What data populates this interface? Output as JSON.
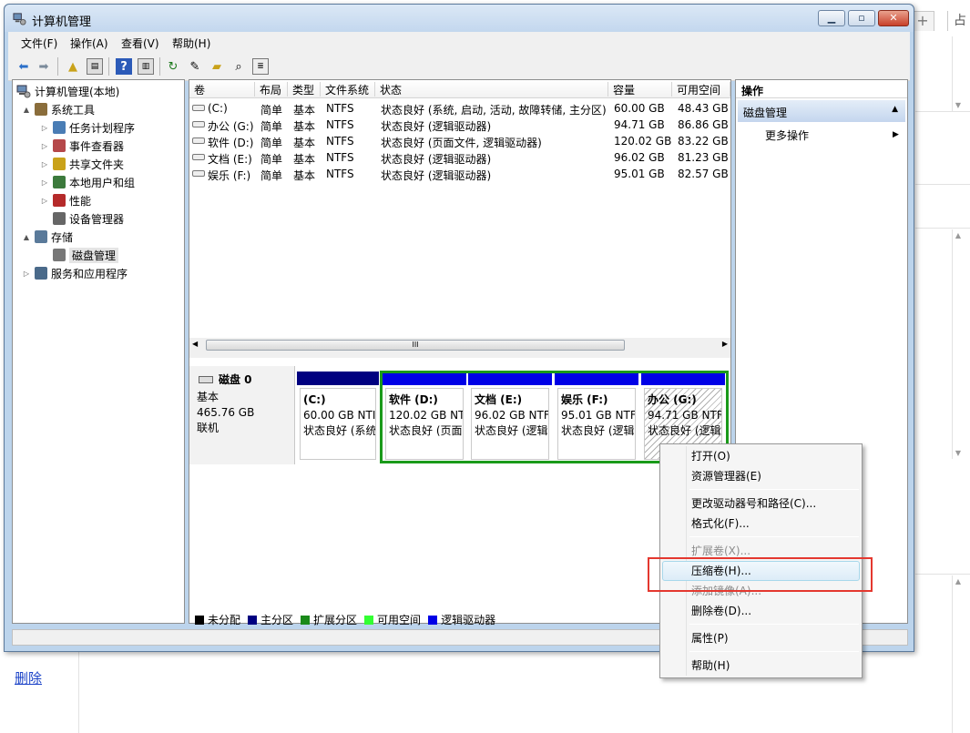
{
  "window": {
    "title": "计算机管理",
    "colors": {
      "accent": "#0000e6",
      "primary_partition": "#000080",
      "extended_partition": "#1a9a1a",
      "highlight": "#e4382f"
    }
  },
  "menubar": [
    "文件(F)",
    "操作(A)",
    "查看(V)",
    "帮助(H)"
  ],
  "toolbar": {
    "icons": [
      "back-arrow-icon",
      "forward-arrow-icon",
      "up-folder-icon",
      "show-hide-tree-icon",
      "help-icon",
      "show-hide-action-icon",
      "refresh-icon",
      "properties-icon",
      "open-folder-icon",
      "search-icon",
      "properties-list-icon"
    ]
  },
  "tree": {
    "root": "计算机管理(本地)",
    "items": [
      {
        "label": "系统工具",
        "level": 1,
        "expander": "▲",
        "icon": "tools-icon"
      },
      {
        "label": "任务计划程序",
        "level": 2,
        "expander": "▷",
        "icon": "clock-icon"
      },
      {
        "label": "事件查看器",
        "level": 2,
        "expander": "▷",
        "icon": "event-viewer-icon"
      },
      {
        "label": "共享文件夹",
        "level": 2,
        "expander": "▷",
        "icon": "shared-folder-icon"
      },
      {
        "label": "本地用户和组",
        "level": 2,
        "expander": "▷",
        "icon": "users-icon"
      },
      {
        "label": "性能",
        "level": 2,
        "expander": "▷",
        "icon": "performance-icon"
      },
      {
        "label": "设备管理器",
        "level": 2,
        "expander": "",
        "icon": "device-manager-icon"
      },
      {
        "label": "存储",
        "level": 1,
        "expander": "▲",
        "icon": "storage-icon"
      },
      {
        "label": "磁盘管理",
        "level": 2,
        "expander": "",
        "icon": "disk-management-icon",
        "selected": true
      },
      {
        "label": "服务和应用程序",
        "level": 1,
        "expander": "▷",
        "icon": "services-icon"
      }
    ]
  },
  "volumes": {
    "columns": [
      "卷",
      "布局",
      "类型",
      "文件系统",
      "状态",
      "容量",
      "可用空间"
    ],
    "rows": [
      [
        "(C:)",
        "简单",
        "基本",
        "NTFS",
        "状态良好 (系统, 启动, 活动, 故障转储, 主分区)",
        "60.00 GB",
        "48.43 GB"
      ],
      [
        "办公 (G:)",
        "简单",
        "基本",
        "NTFS",
        "状态良好 (逻辑驱动器)",
        "94.71 GB",
        "86.86 GB"
      ],
      [
        "软件 (D:)",
        "简单",
        "基本",
        "NTFS",
        "状态良好 (页面文件, 逻辑驱动器)",
        "120.02 GB",
        "83.22 GB"
      ],
      [
        "文档 (E:)",
        "简单",
        "基本",
        "NTFS",
        "状态良好 (逻辑驱动器)",
        "96.02 GB",
        "81.23 GB"
      ],
      [
        "娱乐 (F:)",
        "简单",
        "基本",
        "NTFS",
        "状态良好 (逻辑驱动器)",
        "95.01 GB",
        "82.57 GB"
      ]
    ],
    "scroll_thumb": "III"
  },
  "disk": {
    "name": "磁盘 0",
    "type": "基本",
    "size": "465.76 GB",
    "status": "联机",
    "partitions": [
      {
        "title": "(C:)",
        "size": "60.00 GB NTI",
        "status": "状态良好 (系统"
      },
      {
        "title": "软件 (D:)",
        "size": "120.02 GB NT",
        "status": "状态良好 (页面"
      },
      {
        "title": "文档 (E:)",
        "size": "96.02 GB NTF",
        "status": "状态良好 (逻辑"
      },
      {
        "title": "娱乐 (F:)",
        "size": "95.01 GB NTF",
        "status": "状态良好 (逻辑"
      },
      {
        "title": "办公 (G:)",
        "size": "94.71 GB NTF",
        "status": "状态良好 (逻辑"
      }
    ]
  },
  "legend": [
    {
      "label": "未分配",
      "color": "#000000"
    },
    {
      "label": "主分区",
      "color": "#000080"
    },
    {
      "label": "扩展分区",
      "color": "#1a8a1a"
    },
    {
      "label": "可用空间",
      "color": "#33ff33"
    },
    {
      "label": "逻辑驱动器",
      "color": "#0000e6"
    }
  ],
  "actions": {
    "header": "操作",
    "section": "磁盘管理",
    "more": "更多操作"
  },
  "context_menu": {
    "items": [
      {
        "label": "打开(O)",
        "disabled": false
      },
      {
        "label": "资源管理器(E)",
        "disabled": false
      },
      {
        "label": "更改驱动器号和路径(C)...",
        "disabled": false
      },
      {
        "label": "格式化(F)...",
        "disabled": false
      },
      {
        "label": "扩展卷(X)...",
        "disabled": true
      },
      {
        "label": "压缩卷(H)...",
        "disabled": false,
        "hover": true
      },
      {
        "label": "添加镜像(A)...",
        "disabled": true
      },
      {
        "label": "删除卷(D)...",
        "disabled": false
      },
      {
        "label": "属性(P)",
        "disabled": false
      },
      {
        "label": "帮助(H)",
        "disabled": false
      }
    ]
  },
  "background": {
    "delete_link": "删除",
    "tab_plus": "+",
    "tab_fragment": "占"
  }
}
